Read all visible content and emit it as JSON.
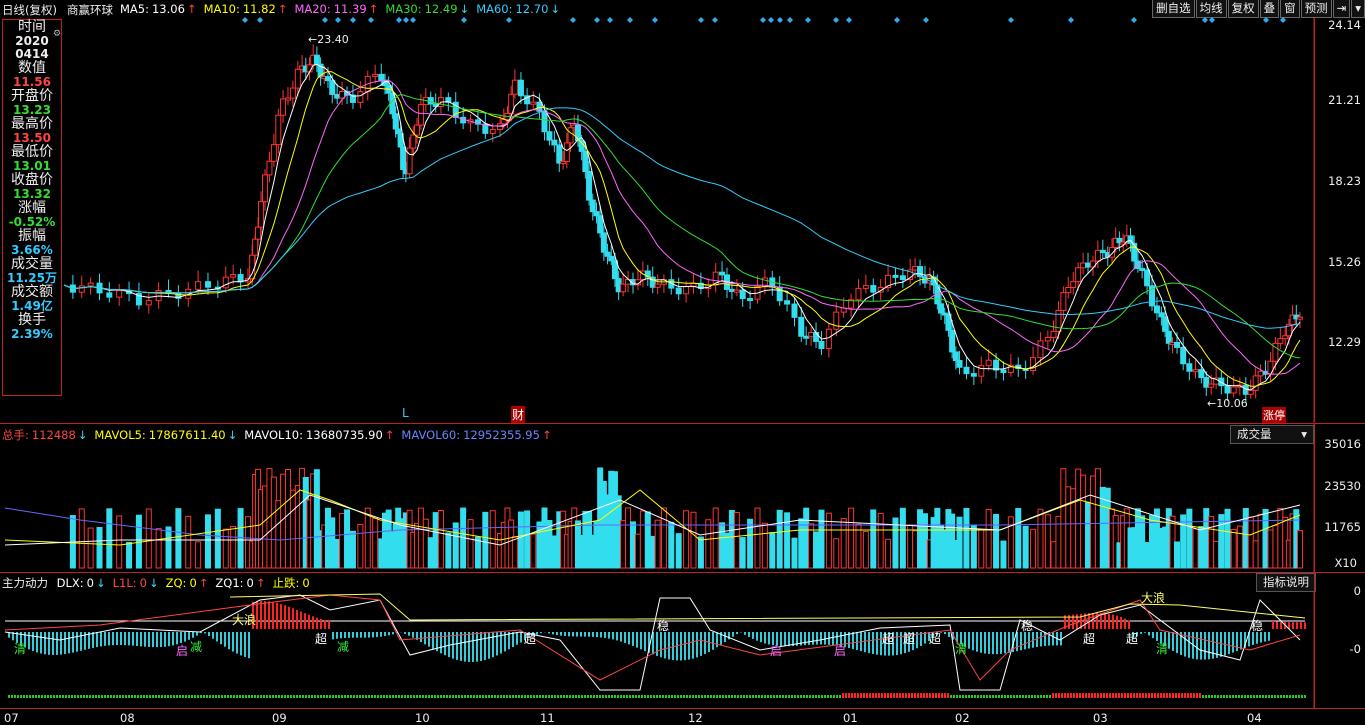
{
  "header": {
    "period": "日线(复权)",
    "stock_name": "商赢环球",
    "ma": [
      {
        "label": "MA5:",
        "value": "13.06",
        "arrow": "↑",
        "color": "#ffffff"
      },
      {
        "label": "MA10:",
        "value": "11.82",
        "arrow": "↑",
        "color": "#ffff00"
      },
      {
        "label": "MA20:",
        "value": "11.39",
        "arrow": "↑",
        "color": "#ff66ff"
      },
      {
        "label": "MA30:",
        "value": "12.49",
        "arrow": "↓",
        "color": "#33dd33"
      },
      {
        "label": "MA60:",
        "value": "12.70",
        "arrow": "↓",
        "color": "#33ccff"
      }
    ]
  },
  "toolbar": {
    "buttons": [
      "删自选",
      "均线",
      "复权",
      "叠",
      "窗",
      "预测"
    ],
    "nav_icon": "⇥",
    "menu_icon": "▾"
  },
  "info_panel": {
    "time_label": "时间",
    "year": "2020",
    "date": "0414",
    "rows": [
      {
        "label": "数值",
        "value": "11.56",
        "color": "#ff4444"
      },
      {
        "label": "开盘价",
        "value": "13.23",
        "color": "#33dd33"
      },
      {
        "label": "最高价",
        "value": "13.50",
        "color": "#ff4444"
      },
      {
        "label": "最低价",
        "value": "13.01",
        "color": "#33dd33"
      },
      {
        "label": "收盘价",
        "value": "13.32",
        "color": "#33dd33"
      },
      {
        "label": "涨幅",
        "value": "-0.52%",
        "color": "#33dd33"
      },
      {
        "label": "振幅",
        "value": "3.66%",
        "color": "#33ccff"
      },
      {
        "label": "成交量",
        "value": "11.25万",
        "color": "#33ccff"
      },
      {
        "label": "成交额",
        "value": "1.49亿",
        "color": "#33ccff"
      },
      {
        "label": "换手",
        "value": "2.39%",
        "color": "#33ccff"
      }
    ]
  },
  "price_axis": [
    "24.14",
    "21.21",
    "18.23",
    "15.26",
    "12.29"
  ],
  "price_annotations": {
    "high": "23.40",
    "low": "10.06",
    "mark_L": "L",
    "mark_cai": "财",
    "mark_zhangting": "涨停"
  },
  "volume_panel": {
    "hdr": [
      {
        "label": "总手:",
        "value": "112488",
        "arrow": "↓",
        "color": "#ff4444"
      },
      {
        "label": "MAVOL5:",
        "value": "17867611.40",
        "arrow": "↓",
        "color": "#ffff00"
      },
      {
        "label": "MAVOL10:",
        "value": "13680735.90",
        "arrow": "↑",
        "color": "#ffffff"
      },
      {
        "label": "MAVOL60:",
        "value": "12952355.95",
        "arrow": "↑",
        "color": "#6688ff"
      }
    ],
    "selector": "成交量",
    "axis": [
      "35016",
      "23530",
      "11765"
    ],
    "unit": "X10"
  },
  "indicator_panel": {
    "name": "主力动力",
    "hdr": [
      {
        "label": "DLX:",
        "value": "0",
        "arrow": "↓",
        "color": "#ffffff"
      },
      {
        "label": "L1L:",
        "value": "0",
        "arrow": "↓",
        "color": "#ff4444"
      },
      {
        "label": "ZQ:",
        "value": "0",
        "arrow": "↑",
        "color": "#ffff00"
      },
      {
        "label": "ZQ1:",
        "value": "0",
        "arrow": "↑",
        "color": "#ffffff"
      },
      {
        "label": "止跌:",
        "value": "0",
        "arrow": "",
        "color": "#ffff00"
      }
    ],
    "help_button": "指标说明",
    "axis": [
      "0",
      "-0"
    ],
    "labels": {
      "dalang": "大浪",
      "chao": "超",
      "qing": "清",
      "jian": "减",
      "qi": "启",
      "wen": "稳"
    }
  },
  "x_axis": [
    "07",
    "08",
    "09",
    "10",
    "11",
    "12",
    "01",
    "02",
    "03",
    "04"
  ],
  "colors": {
    "up": "#ff3333",
    "down": "#33ddee",
    "frame": "#bb2222",
    "ma5": "#ffffff",
    "ma10": "#ffff00",
    "ma20": "#ff66ff",
    "ma30": "#33dd33",
    "ma60": "#33ccff"
  }
}
